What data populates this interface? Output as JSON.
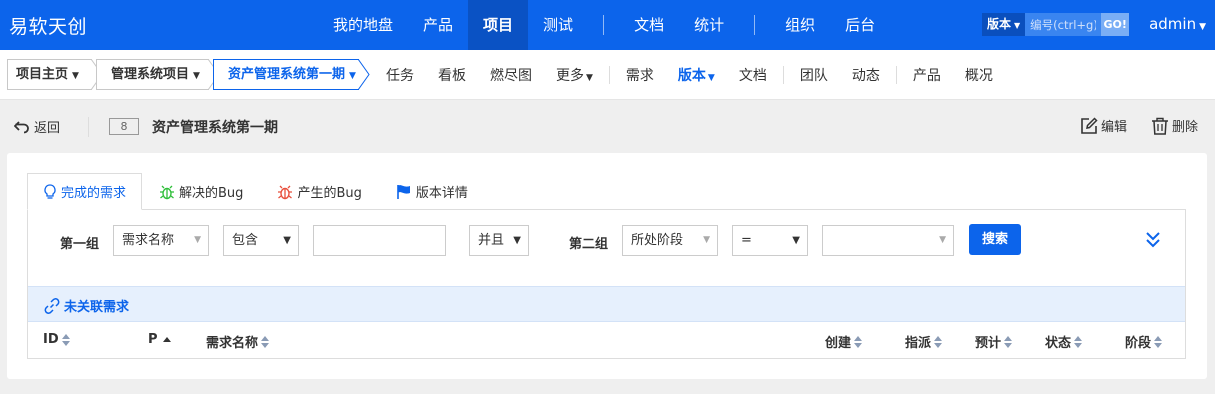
{
  "brand": "易软天创",
  "colors": {
    "primary": "#0c64eb",
    "page_bg": "#efefef",
    "link_bar_bg": "#e6f0fd",
    "bug_fixed": "#2fbe3a",
    "bug_created": "#e8503d"
  },
  "main_nav": {
    "items": [
      "我的地盘",
      "产品",
      "项目",
      "测试",
      "文档",
      "统计",
      "组织",
      "后台"
    ],
    "active": "项目"
  },
  "global_search": {
    "type_label": "版本",
    "placeholder": "编号(ctrl+g)",
    "go_label": "GO!"
  },
  "user": {
    "name": "admin"
  },
  "breadcrumbs": [
    "项目主页",
    "管理系统项目",
    "资产管理系统第一期"
  ],
  "sub_nav": {
    "items": [
      "任务",
      "看板",
      "燃尽图",
      "更多",
      "需求",
      "版本",
      "文档",
      "团队",
      "动态",
      "产品",
      "概况"
    ],
    "active": "版本"
  },
  "title_bar": {
    "back_label": "返回",
    "id": "8",
    "title": "资产管理系统第一期",
    "edit_label": "编辑",
    "delete_label": "删除"
  },
  "tabs": [
    {
      "label": "完成的需求",
      "icon": "lightbulb-icon",
      "active": true
    },
    {
      "label": "解决的Bug",
      "icon": "bug-icon",
      "active": false
    },
    {
      "label": "产生的Bug",
      "icon": "bug-icon",
      "active": false
    },
    {
      "label": "版本详情",
      "icon": "flag-icon",
      "active": false
    }
  ],
  "search_form": {
    "group1_label": "第一组",
    "group1_field": "需求名称",
    "group1_operator": "包含",
    "group1_value": "",
    "logic": "并且",
    "group2_label": "第二组",
    "group2_field": "所处阶段",
    "group2_operator": "=",
    "group2_value": "",
    "search_button": "搜索"
  },
  "link_bar": {
    "label": "未关联需求"
  },
  "table": {
    "columns": [
      "ID",
      "P",
      "需求名称",
      "创建",
      "指派",
      "预计",
      "状态",
      "阶段"
    ],
    "sorted_column": "P",
    "rows": []
  }
}
